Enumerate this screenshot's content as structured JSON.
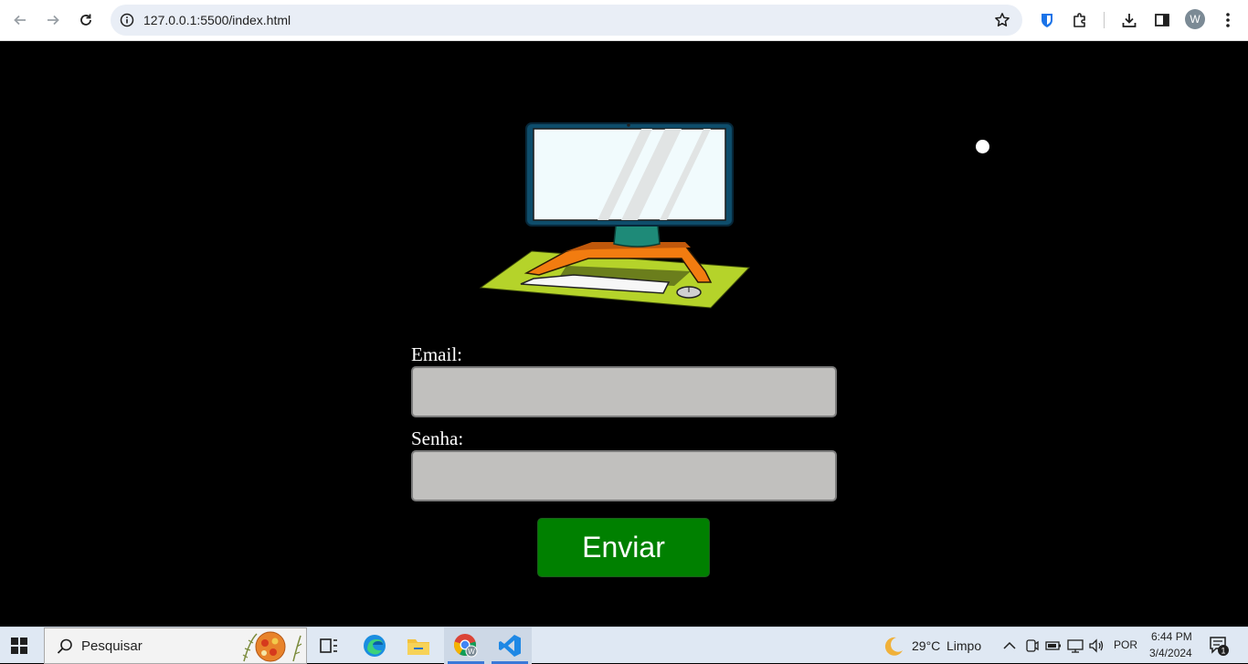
{
  "browser": {
    "url": "127.0.0.1:5500/index.html",
    "profile_initial": "W",
    "icons": [
      "back-icon",
      "forward-icon",
      "reload-icon",
      "site-info-icon",
      "bookmark-star-icon",
      "password-manager-icon",
      "extensions-icon",
      "download-icon",
      "side-panel-icon",
      "profile-avatar",
      "more-menu-icon"
    ]
  },
  "form": {
    "email_label": "Email:",
    "email_value": "",
    "password_label": "Senha:",
    "password_value": "",
    "submit_label": "Enviar"
  },
  "colors": {
    "page_background": "#000000",
    "input_background": "#c1c0be",
    "submit_background": "#008000"
  },
  "taskbar": {
    "search_placeholder": "Pesquisar",
    "apps": [
      "task-view-icon",
      "edge-icon",
      "file-explorer-icon",
      "chrome-icon",
      "vscode-icon"
    ],
    "weather_temp": "29°C",
    "weather_condition": "Limpo",
    "language": "POR",
    "time": "6:44 PM",
    "date": "3/4/2024",
    "notification_count": "1"
  }
}
